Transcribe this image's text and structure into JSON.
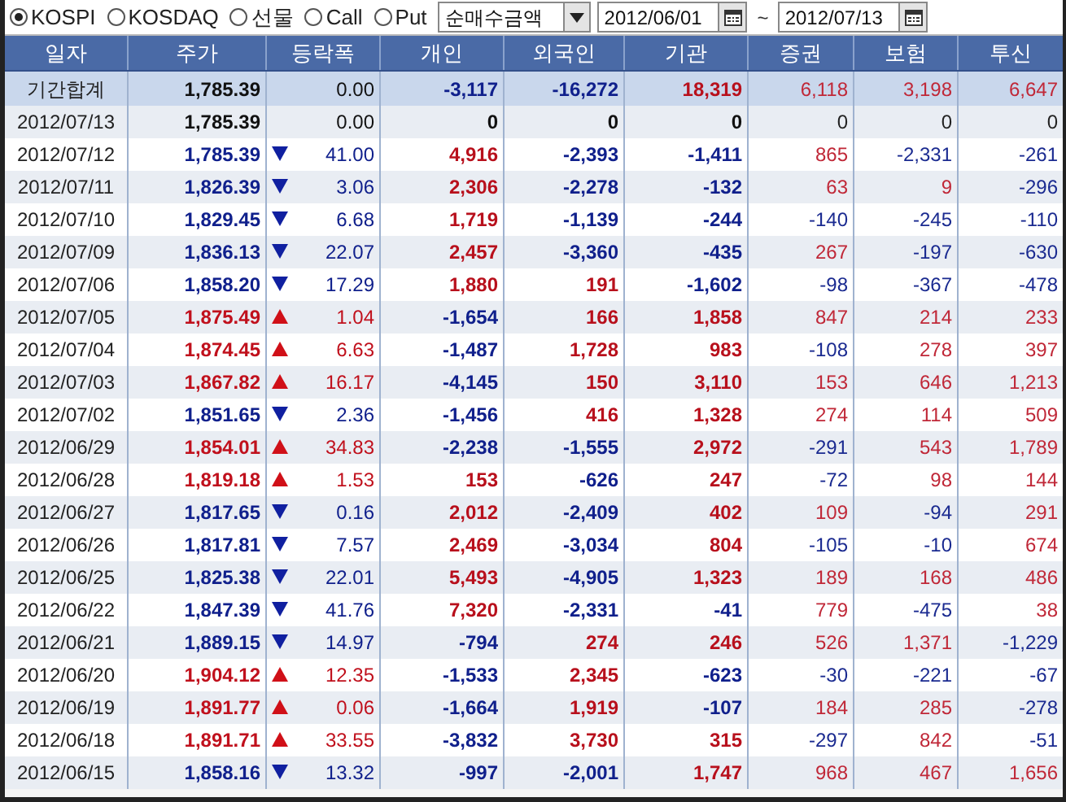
{
  "market_options": [
    {
      "label": "KOSPI",
      "selected": true
    },
    {
      "label": "KOSDAQ",
      "selected": false
    },
    {
      "label": "선물",
      "selected": false
    },
    {
      "label": "Call",
      "selected": false
    },
    {
      "label": "Put",
      "selected": false
    }
  ],
  "metric_dropdown": {
    "value": "순매수금액"
  },
  "date_from": {
    "value": "2012/06/01"
  },
  "range_separator": "~",
  "date_to": {
    "value": "2012/07/13"
  },
  "table": {
    "columns": [
      "일자",
      "주가",
      "등락폭",
      "개인",
      "외국인",
      "기관",
      "증권",
      "보험",
      "투신"
    ],
    "rows": [
      {
        "kind": "total",
        "date": "기간합계",
        "price": "1,785.39",
        "up": false,
        "down": false,
        "change": "0.00",
        "flows": [
          {
            "value": "-3,117",
            "positive": false,
            "negative": true
          },
          {
            "value": "-16,272",
            "positive": false,
            "negative": true
          },
          {
            "value": "18,319",
            "positive": true,
            "negative": false
          },
          {
            "value": "6,118",
            "positive": true,
            "negative": false
          },
          {
            "value": "3,198",
            "positive": true,
            "negative": false
          },
          {
            "value": "6,647",
            "positive": true,
            "negative": false
          }
        ]
      },
      {
        "kind": "day",
        "date": "2012/07/13",
        "price": "1,785.39",
        "up": false,
        "down": false,
        "change": "0.00",
        "flows": [
          {
            "value": "0",
            "positive": false,
            "negative": false
          },
          {
            "value": "0",
            "positive": false,
            "negative": false
          },
          {
            "value": "0",
            "positive": false,
            "negative": false
          },
          {
            "value": "0",
            "positive": false,
            "negative": false
          },
          {
            "value": "0",
            "positive": false,
            "negative": false
          },
          {
            "value": "0",
            "positive": false,
            "negative": false
          }
        ]
      },
      {
        "kind": "day",
        "date": "2012/07/12",
        "price": "1,785.39",
        "up": false,
        "down": true,
        "change": "41.00",
        "flows": [
          {
            "value": "4,916",
            "positive": true,
            "negative": false
          },
          {
            "value": "-2,393",
            "positive": false,
            "negative": true
          },
          {
            "value": "-1,411",
            "positive": false,
            "negative": true
          },
          {
            "value": "865",
            "positive": true,
            "negative": false
          },
          {
            "value": "-2,331",
            "positive": false,
            "negative": true
          },
          {
            "value": "-261",
            "positive": false,
            "negative": true
          }
        ]
      },
      {
        "kind": "day",
        "date": "2012/07/11",
        "price": "1,826.39",
        "up": false,
        "down": true,
        "change": "3.06",
        "flows": [
          {
            "value": "2,306",
            "positive": true,
            "negative": false
          },
          {
            "value": "-2,278",
            "positive": false,
            "negative": true
          },
          {
            "value": "-132",
            "positive": false,
            "negative": true
          },
          {
            "value": "63",
            "positive": true,
            "negative": false
          },
          {
            "value": "9",
            "positive": true,
            "negative": false
          },
          {
            "value": "-296",
            "positive": false,
            "negative": true
          }
        ]
      },
      {
        "kind": "day",
        "date": "2012/07/10",
        "price": "1,829.45",
        "up": false,
        "down": true,
        "change": "6.68",
        "flows": [
          {
            "value": "1,719",
            "positive": true,
            "negative": false
          },
          {
            "value": "-1,139",
            "positive": false,
            "negative": true
          },
          {
            "value": "-244",
            "positive": false,
            "negative": true
          },
          {
            "value": "-140",
            "positive": false,
            "negative": true
          },
          {
            "value": "-245",
            "positive": false,
            "negative": true
          },
          {
            "value": "-110",
            "positive": false,
            "negative": true
          }
        ]
      },
      {
        "kind": "day",
        "date": "2012/07/09",
        "price": "1,836.13",
        "up": false,
        "down": true,
        "change": "22.07",
        "flows": [
          {
            "value": "2,457",
            "positive": true,
            "negative": false
          },
          {
            "value": "-3,360",
            "positive": false,
            "negative": true
          },
          {
            "value": "-435",
            "positive": false,
            "negative": true
          },
          {
            "value": "267",
            "positive": true,
            "negative": false
          },
          {
            "value": "-197",
            "positive": false,
            "negative": true
          },
          {
            "value": "-630",
            "positive": false,
            "negative": true
          }
        ]
      },
      {
        "kind": "day",
        "date": "2012/07/06",
        "price": "1,858.20",
        "up": false,
        "down": true,
        "change": "17.29",
        "flows": [
          {
            "value": "1,880",
            "positive": true,
            "negative": false
          },
          {
            "value": "191",
            "positive": true,
            "negative": false
          },
          {
            "value": "-1,602",
            "positive": false,
            "negative": true
          },
          {
            "value": "-98",
            "positive": false,
            "negative": true
          },
          {
            "value": "-367",
            "positive": false,
            "negative": true
          },
          {
            "value": "-478",
            "positive": false,
            "negative": true
          }
        ]
      },
      {
        "kind": "day",
        "date": "2012/07/05",
        "price": "1,875.49",
        "up": true,
        "down": false,
        "change": "1.04",
        "flows": [
          {
            "value": "-1,654",
            "positive": false,
            "negative": true
          },
          {
            "value": "166",
            "positive": true,
            "negative": false
          },
          {
            "value": "1,858",
            "positive": true,
            "negative": false
          },
          {
            "value": "847",
            "positive": true,
            "negative": false
          },
          {
            "value": "214",
            "positive": true,
            "negative": false
          },
          {
            "value": "233",
            "positive": true,
            "negative": false
          }
        ]
      },
      {
        "kind": "day",
        "date": "2012/07/04",
        "price": "1,874.45",
        "up": true,
        "down": false,
        "change": "6.63",
        "flows": [
          {
            "value": "-1,487",
            "positive": false,
            "negative": true
          },
          {
            "value": "1,728",
            "positive": true,
            "negative": false
          },
          {
            "value": "983",
            "positive": true,
            "negative": false
          },
          {
            "value": "-108",
            "positive": false,
            "negative": true
          },
          {
            "value": "278",
            "positive": true,
            "negative": false
          },
          {
            "value": "397",
            "positive": true,
            "negative": false
          }
        ]
      },
      {
        "kind": "day",
        "date": "2012/07/03",
        "price": "1,867.82",
        "up": true,
        "down": false,
        "change": "16.17",
        "flows": [
          {
            "value": "-4,145",
            "positive": false,
            "negative": true
          },
          {
            "value": "150",
            "positive": true,
            "negative": false
          },
          {
            "value": "3,110",
            "positive": true,
            "negative": false
          },
          {
            "value": "153",
            "positive": true,
            "negative": false
          },
          {
            "value": "646",
            "positive": true,
            "negative": false
          },
          {
            "value": "1,213",
            "positive": true,
            "negative": false
          }
        ]
      },
      {
        "kind": "day",
        "date": "2012/07/02",
        "price": "1,851.65",
        "up": false,
        "down": true,
        "change": "2.36",
        "flows": [
          {
            "value": "-1,456",
            "positive": false,
            "negative": true
          },
          {
            "value": "416",
            "positive": true,
            "negative": false
          },
          {
            "value": "1,328",
            "positive": true,
            "negative": false
          },
          {
            "value": "274",
            "positive": true,
            "negative": false
          },
          {
            "value": "114",
            "positive": true,
            "negative": false
          },
          {
            "value": "509",
            "positive": true,
            "negative": false
          }
        ]
      },
      {
        "kind": "day",
        "date": "2012/06/29",
        "price": "1,854.01",
        "up": true,
        "down": false,
        "change": "34.83",
        "flows": [
          {
            "value": "-2,238",
            "positive": false,
            "negative": true
          },
          {
            "value": "-1,555",
            "positive": false,
            "negative": true
          },
          {
            "value": "2,972",
            "positive": true,
            "negative": false
          },
          {
            "value": "-291",
            "positive": false,
            "negative": true
          },
          {
            "value": "543",
            "positive": true,
            "negative": false
          },
          {
            "value": "1,789",
            "positive": true,
            "negative": false
          }
        ]
      },
      {
        "kind": "day",
        "date": "2012/06/28",
        "price": "1,819.18",
        "up": true,
        "down": false,
        "change": "1.53",
        "flows": [
          {
            "value": "153",
            "positive": true,
            "negative": false
          },
          {
            "value": "-626",
            "positive": false,
            "negative": true
          },
          {
            "value": "247",
            "positive": true,
            "negative": false
          },
          {
            "value": "-72",
            "positive": false,
            "negative": true
          },
          {
            "value": "98",
            "positive": true,
            "negative": false
          },
          {
            "value": "144",
            "positive": true,
            "negative": false
          }
        ]
      },
      {
        "kind": "day",
        "date": "2012/06/27",
        "price": "1,817.65",
        "up": false,
        "down": true,
        "change": "0.16",
        "flows": [
          {
            "value": "2,012",
            "positive": true,
            "negative": false
          },
          {
            "value": "-2,409",
            "positive": false,
            "negative": true
          },
          {
            "value": "402",
            "positive": true,
            "negative": false
          },
          {
            "value": "109",
            "positive": true,
            "negative": false
          },
          {
            "value": "-94",
            "positive": false,
            "negative": true
          },
          {
            "value": "291",
            "positive": true,
            "negative": false
          }
        ]
      },
      {
        "kind": "day",
        "date": "2012/06/26",
        "price": "1,817.81",
        "up": false,
        "down": true,
        "change": "7.57",
        "flows": [
          {
            "value": "2,469",
            "positive": true,
            "negative": false
          },
          {
            "value": "-3,034",
            "positive": false,
            "negative": true
          },
          {
            "value": "804",
            "positive": true,
            "negative": false
          },
          {
            "value": "-105",
            "positive": false,
            "negative": true
          },
          {
            "value": "-10",
            "positive": false,
            "negative": true
          },
          {
            "value": "674",
            "positive": true,
            "negative": false
          }
        ]
      },
      {
        "kind": "day",
        "date": "2012/06/25",
        "price": "1,825.38",
        "up": false,
        "down": true,
        "change": "22.01",
        "flows": [
          {
            "value": "5,493",
            "positive": true,
            "negative": false
          },
          {
            "value": "-4,905",
            "positive": false,
            "negative": true
          },
          {
            "value": "1,323",
            "positive": true,
            "negative": false
          },
          {
            "value": "189",
            "positive": true,
            "negative": false
          },
          {
            "value": "168",
            "positive": true,
            "negative": false
          },
          {
            "value": "486",
            "positive": true,
            "negative": false
          }
        ]
      },
      {
        "kind": "day",
        "date": "2012/06/22",
        "price": "1,847.39",
        "up": false,
        "down": true,
        "change": "41.76",
        "flows": [
          {
            "value": "7,320",
            "positive": true,
            "negative": false
          },
          {
            "value": "-2,331",
            "positive": false,
            "negative": true
          },
          {
            "value": "-41",
            "positive": false,
            "negative": true
          },
          {
            "value": "779",
            "positive": true,
            "negative": false
          },
          {
            "value": "-475",
            "positive": false,
            "negative": true
          },
          {
            "value": "38",
            "positive": true,
            "negative": false
          }
        ]
      },
      {
        "kind": "day",
        "date": "2012/06/21",
        "price": "1,889.15",
        "up": false,
        "down": true,
        "change": "14.97",
        "flows": [
          {
            "value": "-794",
            "positive": false,
            "negative": true
          },
          {
            "value": "274",
            "positive": true,
            "negative": false
          },
          {
            "value": "246",
            "positive": true,
            "negative": false
          },
          {
            "value": "526",
            "positive": true,
            "negative": false
          },
          {
            "value": "1,371",
            "positive": true,
            "negative": false
          },
          {
            "value": "-1,229",
            "positive": false,
            "negative": true
          }
        ]
      },
      {
        "kind": "day",
        "date": "2012/06/20",
        "price": "1,904.12",
        "up": true,
        "down": false,
        "change": "12.35",
        "flows": [
          {
            "value": "-1,533",
            "positive": false,
            "negative": true
          },
          {
            "value": "2,345",
            "positive": true,
            "negative": false
          },
          {
            "value": "-623",
            "positive": false,
            "negative": true
          },
          {
            "value": "-30",
            "positive": false,
            "negative": true
          },
          {
            "value": "-221",
            "positive": false,
            "negative": true
          },
          {
            "value": "-67",
            "positive": false,
            "negative": true
          }
        ]
      },
      {
        "kind": "day",
        "date": "2012/06/19",
        "price": "1,891.77",
        "up": true,
        "down": false,
        "change": "0.06",
        "flows": [
          {
            "value": "-1,664",
            "positive": false,
            "negative": true
          },
          {
            "value": "1,919",
            "positive": true,
            "negative": false
          },
          {
            "value": "-107",
            "positive": false,
            "negative": true
          },
          {
            "value": "184",
            "positive": true,
            "negative": false
          },
          {
            "value": "285",
            "positive": true,
            "negative": false
          },
          {
            "value": "-278",
            "positive": false,
            "negative": true
          }
        ]
      },
      {
        "kind": "day",
        "date": "2012/06/18",
        "price": "1,891.71",
        "up": true,
        "down": false,
        "change": "33.55",
        "flows": [
          {
            "value": "-3,832",
            "positive": false,
            "negative": true
          },
          {
            "value": "3,730",
            "positive": true,
            "negative": false
          },
          {
            "value": "315",
            "positive": true,
            "negative": false
          },
          {
            "value": "-297",
            "positive": false,
            "negative": true
          },
          {
            "value": "842",
            "positive": true,
            "negative": false
          },
          {
            "value": "-51",
            "positive": false,
            "negative": true
          }
        ]
      },
      {
        "kind": "day",
        "date": "2012/06/15",
        "price": "1,858.16",
        "up": false,
        "down": true,
        "change": "13.32",
        "flows": [
          {
            "value": "-997",
            "positive": false,
            "negative": true
          },
          {
            "value": "-2,001",
            "positive": false,
            "negative": true
          },
          {
            "value": "1,747",
            "positive": true,
            "negative": false
          },
          {
            "value": "968",
            "positive": true,
            "negative": false
          },
          {
            "value": "467",
            "positive": true,
            "negative": false
          },
          {
            "value": "1,656",
            "positive": true,
            "negative": false
          }
        ]
      }
    ]
  }
}
